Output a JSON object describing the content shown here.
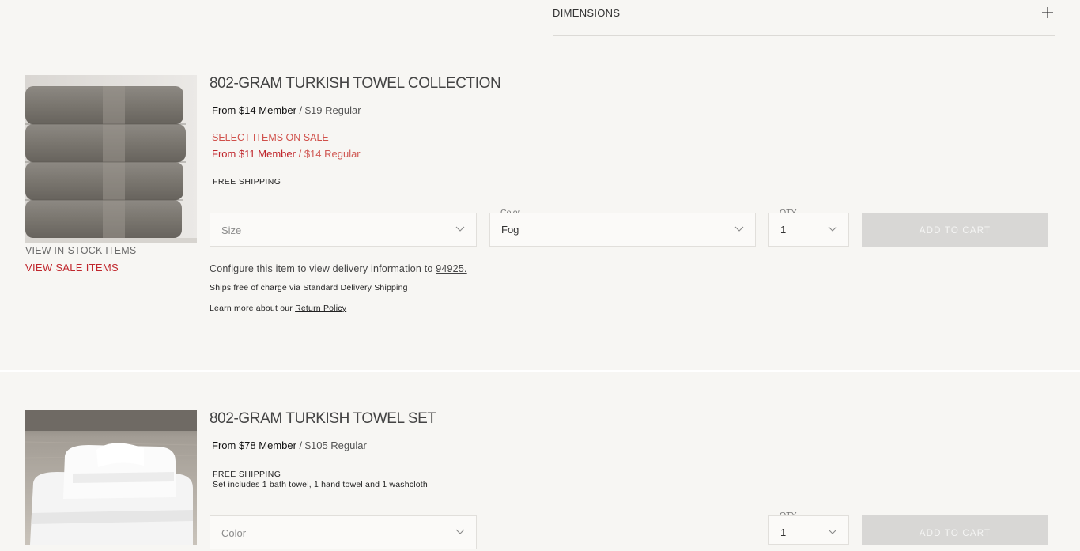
{
  "accordion": {
    "label": "DIMENSIONS",
    "icon": "plus-icon"
  },
  "product1": {
    "title": "802-GRAM TURKISH TOWEL COLLECTION",
    "price_member": "From $14 Member",
    "price_sep": " / ",
    "price_regular": "$19 Regular",
    "sale_label": "SELECT ITEMS ON SALE",
    "sale_member": "From $11 Member",
    "sale_sep": " / ",
    "sale_regular": "$14 Regular",
    "shipping": "FREE SHIPPING",
    "size_placeholder": "Size",
    "color_label": "Color",
    "color_value": "Fog",
    "qty_label": "QTY",
    "qty_value": "1",
    "add_to_cart": "ADD TO CART",
    "view_in_stock": "VIEW IN-STOCK ITEMS",
    "view_sale": "VIEW SALE ITEMS",
    "delivery_text": "Configure this item to view delivery information to ",
    "zip": "94925.",
    "ships_text": "Ships free of charge via Standard Delivery Shipping",
    "learn_text": "Learn more about our ",
    "return_policy": "Return Policy"
  },
  "product2": {
    "title": "802-GRAM TURKISH TOWEL SET",
    "price_member": "From $78 Member",
    "price_sep": " / ",
    "price_regular": "$105 Regular",
    "shipping": "FREE SHIPPING",
    "set_includes": "Set includes 1 bath towel, 1 hand towel and 1 washcloth",
    "color_placeholder": "Color",
    "qty_label": "QTY",
    "qty_value": "1",
    "add_to_cart": "ADD TO CART"
  },
  "colors": {
    "background": "#f7f6f3",
    "sale_red": "#c0272d",
    "disabled_button": "#d8d7d5"
  }
}
